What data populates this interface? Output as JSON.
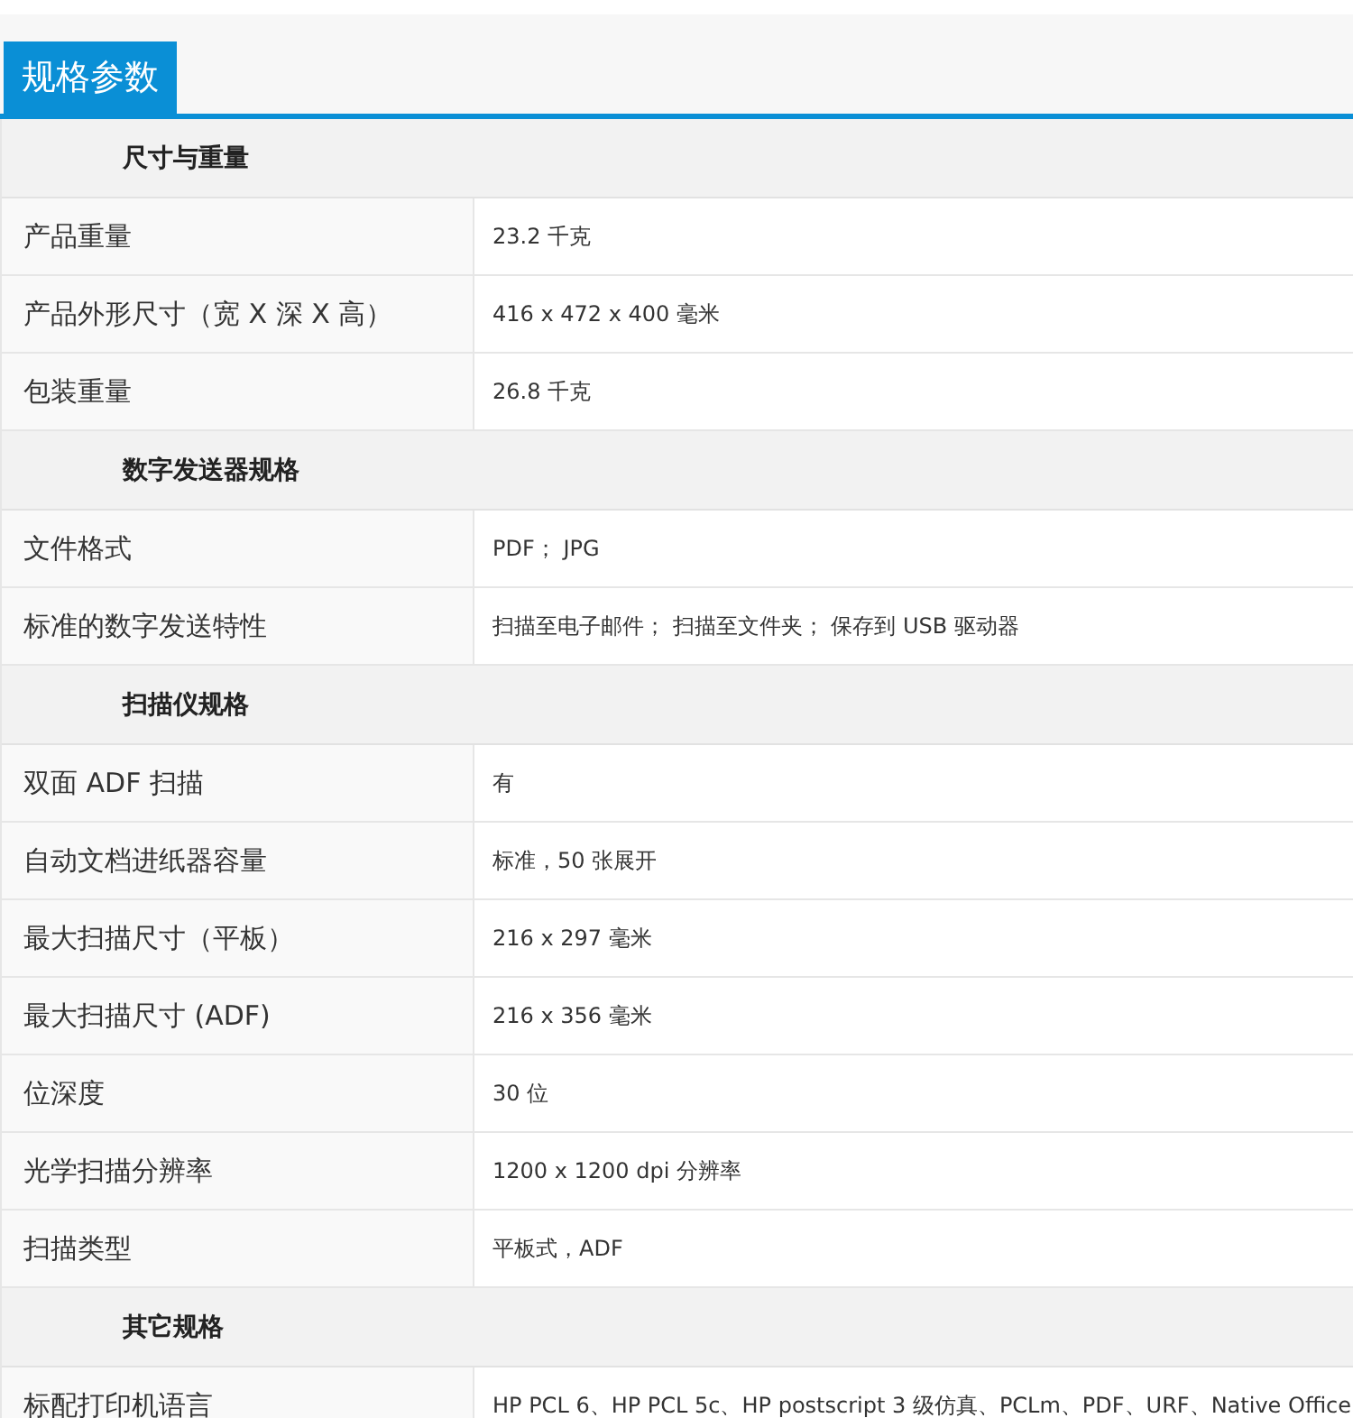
{
  "tab": {
    "label": "规格参数",
    "selected": true
  },
  "sections": [
    {
      "title": "尺寸与重量",
      "rows": [
        {
          "label": "产品重量",
          "value": "23.2 千克"
        },
        {
          "label": "产品外形尺寸（宽 X 深 X 高）",
          "value": "416 x 472 x 400 毫米"
        },
        {
          "label": "包装重量",
          "value": "26.8 千克"
        }
      ]
    },
    {
      "title": "数字发送器规格",
      "rows": [
        {
          "label": "文件格式",
          "value": "PDF； JPG"
        },
        {
          "label": "标准的数字发送特性",
          "value": "扫描至电子邮件； 扫描至文件夹； 保存到 USB 驱动器"
        }
      ]
    },
    {
      "title": "扫描仪规格",
      "rows": [
        {
          "label": "双面 ADF 扫描",
          "value": "有"
        },
        {
          "label": "自动文档进纸器容量",
          "value": "标准，50 张展开"
        },
        {
          "label": "最大扫描尺寸（平板）",
          "value": "216 x 297 毫米"
        },
        {
          "label": "最大扫描尺寸 (ADF)",
          "value": "216 x 356 毫米"
        },
        {
          "label": "位深度",
          "value": "30 位"
        },
        {
          "label": "光学扫描分辨率",
          "value": "1200 x 1200 dpi 分辨率"
        },
        {
          "label": "扫描类型",
          "value": "平板式，ADF"
        }
      ]
    },
    {
      "title": "其它规格",
      "rows": [
        {
          "label": "标配打印机语言",
          "value": "HP PCL 6、HP PCL 5c、HP postscript 3 级仿真、PCLm、PDF、URF、Native Office"
        }
      ]
    }
  ]
}
